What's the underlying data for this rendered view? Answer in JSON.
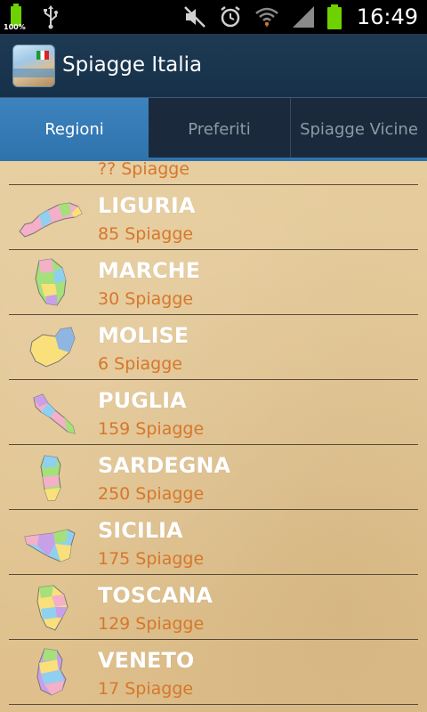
{
  "status_bar": {
    "battery_small_label": "100%",
    "time": "16:49",
    "icons": [
      "battery-icon",
      "usb-icon",
      "mute-icon",
      "alarm-icon",
      "wifi-icon",
      "signal-icon",
      "battery-icon"
    ]
  },
  "app": {
    "title": "Spiagge Italia"
  },
  "tabs": [
    {
      "label": "Regioni",
      "active": true
    },
    {
      "label": "Preferiti",
      "active": false
    },
    {
      "label": "Spiagge Vicine",
      "active": false
    }
  ],
  "regions": [
    {
      "name": "",
      "count": "?? Spiagge"
    },
    {
      "name": "LIGURIA",
      "count": "85 Spiagge"
    },
    {
      "name": "MARCHE",
      "count": "30 Spiagge"
    },
    {
      "name": "MOLISE",
      "count": "6 Spiagge"
    },
    {
      "name": "PUGLIA",
      "count": "159 Spiagge"
    },
    {
      "name": "SARDEGNA",
      "count": "250 Spiagge"
    },
    {
      "name": "SICILIA",
      "count": "175 Spiagge"
    },
    {
      "name": "TOSCANA",
      "count": "129 Spiagge"
    },
    {
      "name": "VENETO",
      "count": "17 Spiagge"
    }
  ],
  "colors": {
    "accent": "#2f73ad",
    "count_text": "#d6772b",
    "battery_green": "#6fd100"
  }
}
